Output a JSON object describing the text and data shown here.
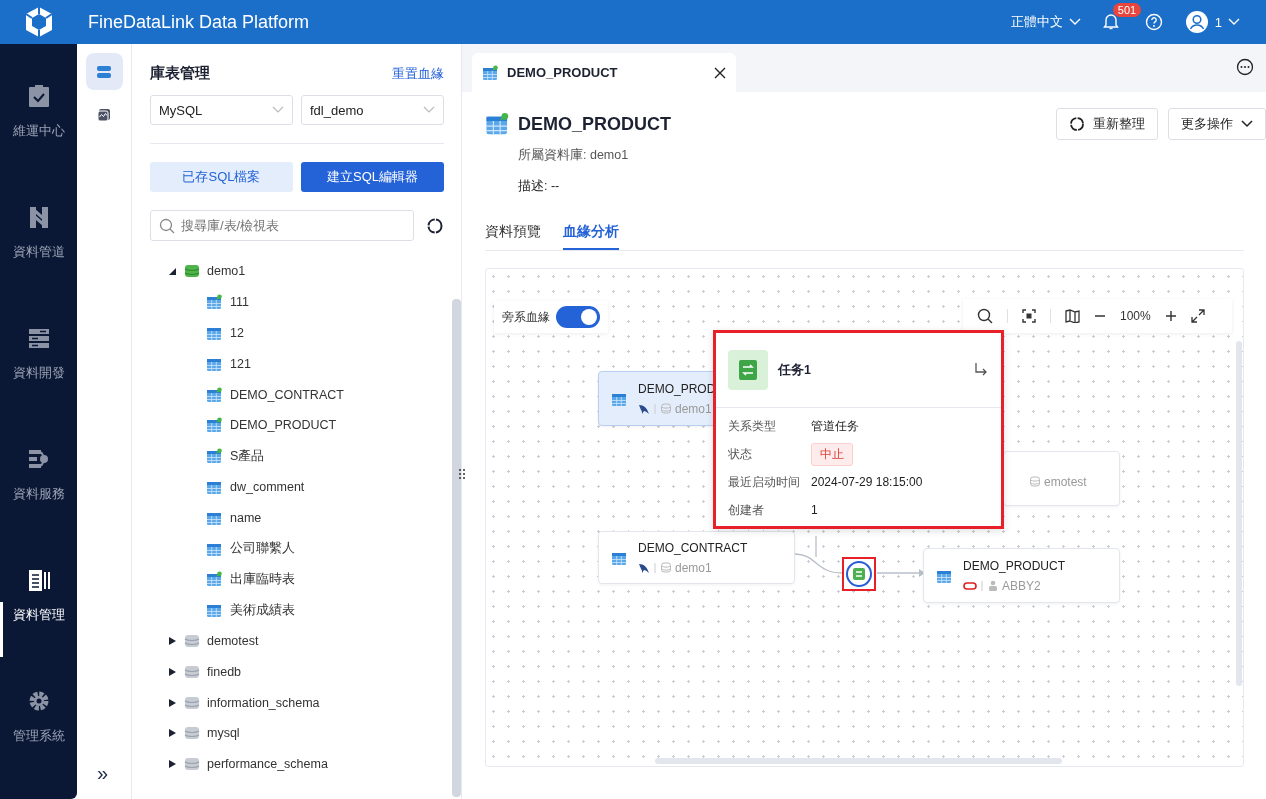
{
  "header": {
    "title": "FineDataLink Data Platform",
    "language": "正體中文",
    "notification_count": "501",
    "user": "1"
  },
  "nav": {
    "items": [
      {
        "label": "維運中心",
        "selected": false
      },
      {
        "label": "資料管道",
        "selected": false
      },
      {
        "label": "資料開發",
        "selected": false
      },
      {
        "label": "資料服務",
        "selected": false
      },
      {
        "label": "資料管理",
        "selected": true
      },
      {
        "label": "管理系統",
        "selected": false
      }
    ],
    "expand_glyph": "»"
  },
  "subnav": {
    "items": [
      {
        "kind": "database",
        "selected": true
      },
      {
        "kind": "monitor",
        "selected": false
      }
    ]
  },
  "panel": {
    "title": "庫表管理",
    "reset_link": "重置血緣",
    "selects": [
      {
        "value": "MySQL"
      },
      {
        "value": "fdl_demo"
      }
    ],
    "buttons": [
      {
        "label": "已存SQL檔案",
        "kind": "secondary"
      },
      {
        "label": "建立SQL編輯器",
        "kind": "primary"
      }
    ],
    "search": {
      "placeholder": "搜尋庫/表/檢視表"
    },
    "tree": [
      {
        "label": "demo1",
        "expanded": true,
        "children": [
          {
            "label": "111",
            "synced": true
          },
          {
            "label": "12",
            "synced": false
          },
          {
            "label": "121",
            "synced": false
          },
          {
            "label": "DEMO_CONTRACT",
            "synced": true
          },
          {
            "label": "DEMO_PRODUCT",
            "synced": true
          },
          {
            "label": "S產品",
            "synced": true
          },
          {
            "label": "dw_comment",
            "synced": false
          },
          {
            "label": "name",
            "synced": false
          },
          {
            "label": "公司聯繫人",
            "synced": false
          },
          {
            "label": "出庫臨時表",
            "synced": true
          },
          {
            "label": "美術成績表",
            "synced": false
          }
        ]
      },
      {
        "label": "demotest",
        "expanded": false
      },
      {
        "label": "finedb",
        "expanded": false
      },
      {
        "label": "information_schema",
        "expanded": false
      },
      {
        "label": "mysql",
        "expanded": false
      },
      {
        "label": "performance_schema",
        "expanded": false
      }
    ]
  },
  "main": {
    "tab": {
      "title": "DEMO_PRODUCT"
    },
    "title": "DEMO_PRODUCT",
    "database_label": "所屬資料庫: demo1",
    "description": "描述: --",
    "actions": [
      {
        "label": "重新整理",
        "kind": "refresh"
      },
      {
        "label": "更多操作",
        "kind": "dropdown"
      }
    ],
    "subtabs": [
      {
        "label": "資料預覽",
        "selected": false
      },
      {
        "label": "血緣分析",
        "selected": true
      }
    ],
    "lineage": {
      "toggle": {
        "label": "旁系血緣",
        "on": true
      },
      "zoom": "100%",
      "nodes": [
        {
          "title": "DEMO_PROD",
          "source": "demo1",
          "kind": "mysql",
          "selected": true
        },
        {
          "source": "emotest",
          "kind": "partial",
          "selected": false
        },
        {
          "title": "DEMO_CONTRACT",
          "source": "demo1",
          "kind": "mysql",
          "selected": false
        },
        {
          "title": "DEMO_PRODUCT",
          "source": "ABBY2",
          "kind": "oracle",
          "selected": false
        }
      ],
      "popup": {
        "title": "任务1",
        "rows": [
          {
            "label": "关系类型",
            "value": "管道任务",
            "kind": "text"
          },
          {
            "label": "状态",
            "value": "中止",
            "kind": "status"
          },
          {
            "label": "最近启动时间",
            "value": "2024-07-29 18:15:00",
            "kind": "text"
          },
          {
            "label": "创建者",
            "value": "1",
            "kind": "text"
          }
        ]
      }
    }
  }
}
